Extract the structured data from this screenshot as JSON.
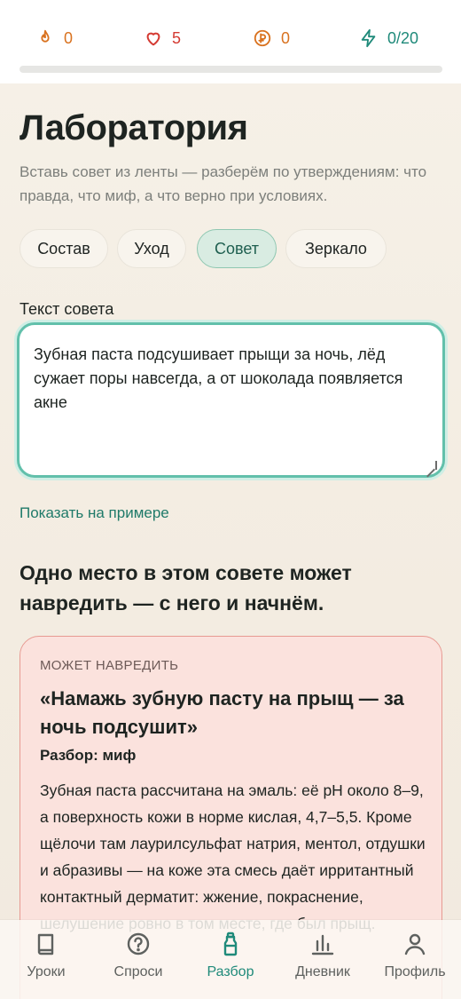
{
  "stats": {
    "streak": "0",
    "hearts": "5",
    "coins": "0",
    "energy": "0/20",
    "progress_fraction": 0
  },
  "page": {
    "title": "Лаборатория",
    "subtitle": "Вставь совет из ленты — разберём по утверждениям: что правда, что миф, а что верно при условиях."
  },
  "chips": [
    {
      "label": "Состав",
      "active": false
    },
    {
      "label": "Уход",
      "active": false
    },
    {
      "label": "Совет",
      "active": true
    },
    {
      "label": "Зеркало",
      "active": false
    }
  ],
  "input": {
    "label": "Текст совета",
    "value": "Зубная паста подсушивает прыщи за ночь, лёд сужает поры навсегда, а от шоколада появляется акне",
    "example_link": "Показать на примере"
  },
  "lead": "Одно место в этом совете может навредить — с него и начнём.",
  "card": {
    "tag": "МОЖЕТ НАВРЕДИТЬ",
    "title": "«Намажь зубную пасту на прыщ — за ночь подсушит»",
    "verdict": "Разбор: миф",
    "body": "Зубная паста рассчитана на эмаль: её pH около 8–9, а поверхность кожи в норме кислая, 4,7–5,5. Кроме щёлочи там лаурилсульфат натрия, ментол, отдушки и абразивы — на коже эта смесь даёт ирритантный контактный дерматит: жжение, покраснение, шелушение ровно в том месте, где был прыщ."
  },
  "tabs": [
    {
      "label": "Уроки",
      "icon": "book-icon",
      "active": false
    },
    {
      "label": "Спроси",
      "icon": "question-icon",
      "active": false
    },
    {
      "label": "Разбор",
      "icon": "bottle-icon",
      "active": true
    },
    {
      "label": "Дневник",
      "icon": "chart-icon",
      "active": false
    },
    {
      "label": "Профиль",
      "icon": "profile-icon",
      "active": false
    }
  ],
  "colors": {
    "accent": "#1f8a7a",
    "streak": "#d9721f",
    "hearts": "#d43a32",
    "card_bg": "#fbe2dd",
    "card_border": "#e79a92"
  }
}
